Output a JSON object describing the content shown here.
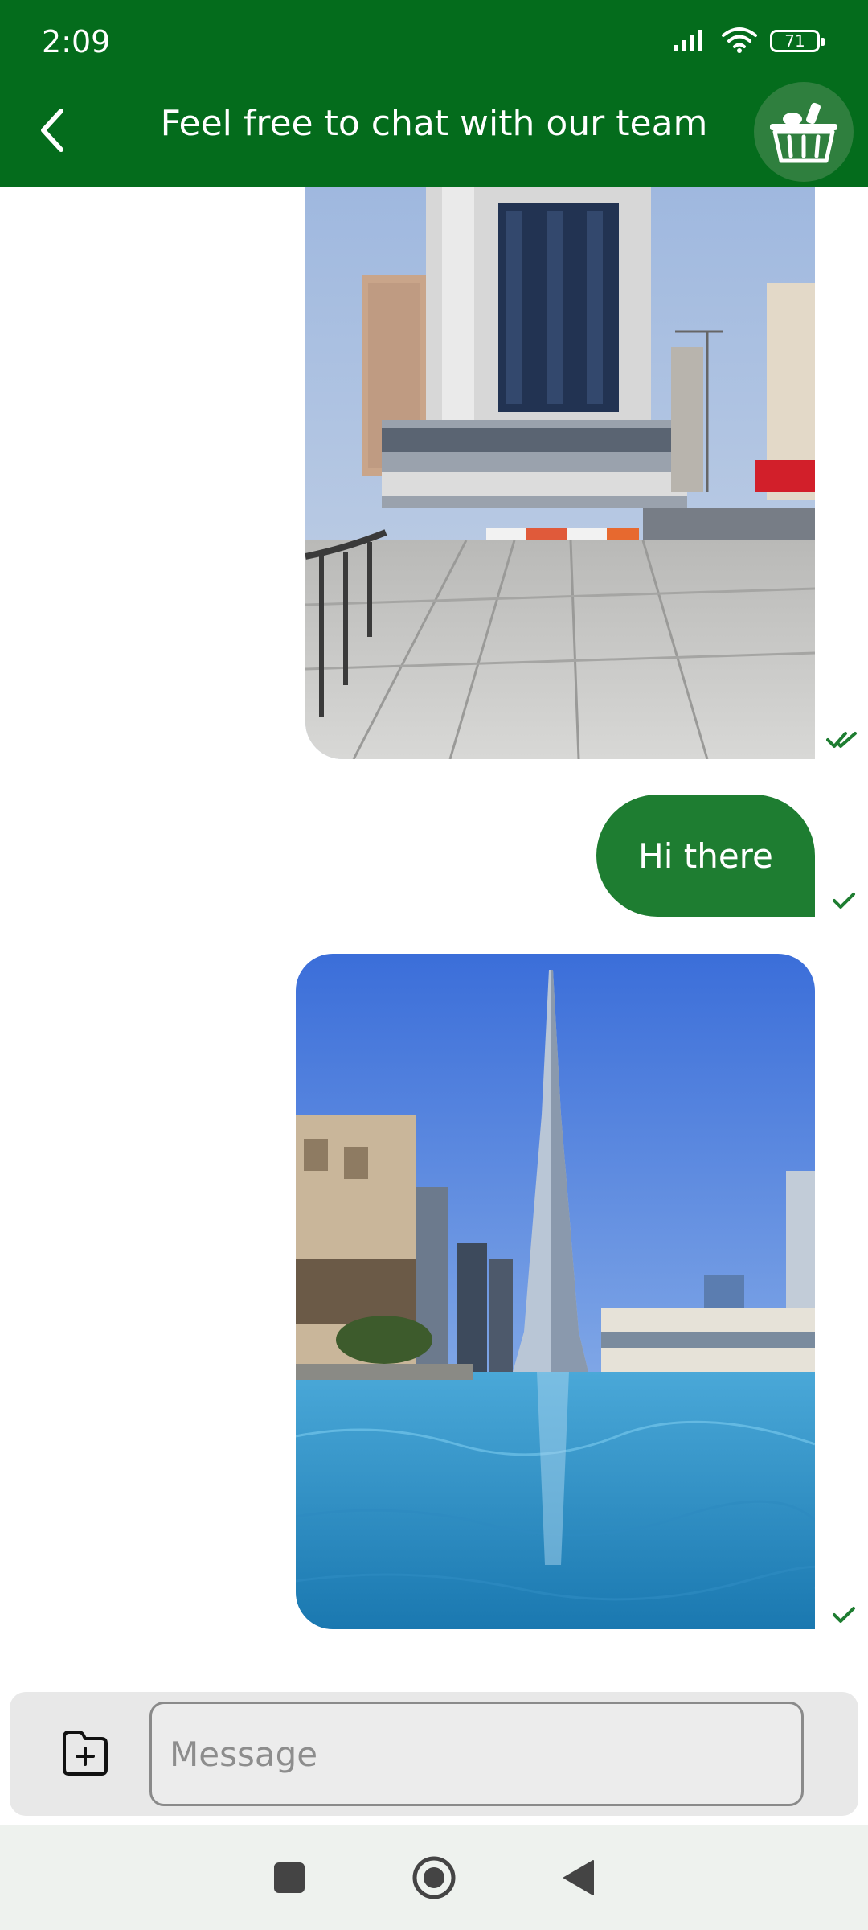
{
  "status_bar": {
    "time": "2:09",
    "battery": "71"
  },
  "header": {
    "title": "Feel free to chat with our team",
    "back_icon": "chevron-left-icon",
    "avatar_icon": "basket-icon",
    "color": "#046c1c"
  },
  "messages": [
    {
      "type": "image",
      "alt": "Downtown tower with paved plaza",
      "status": "read"
    },
    {
      "type": "text",
      "text": "Hi there",
      "status": "sent"
    },
    {
      "type": "image",
      "alt": "Burj Khalifa with fountain lake",
      "status": "sent"
    }
  ],
  "composer": {
    "placeholder": "Message",
    "attach_icon": "folder-plus-icon"
  },
  "nav": {
    "recents_icon": "square-icon",
    "home_icon": "circle-icon",
    "back_icon": "triangle-back-icon"
  },
  "colors": {
    "accent": "#046c1c",
    "bubble": "#1e7d31",
    "tick": "#1e7d31"
  }
}
